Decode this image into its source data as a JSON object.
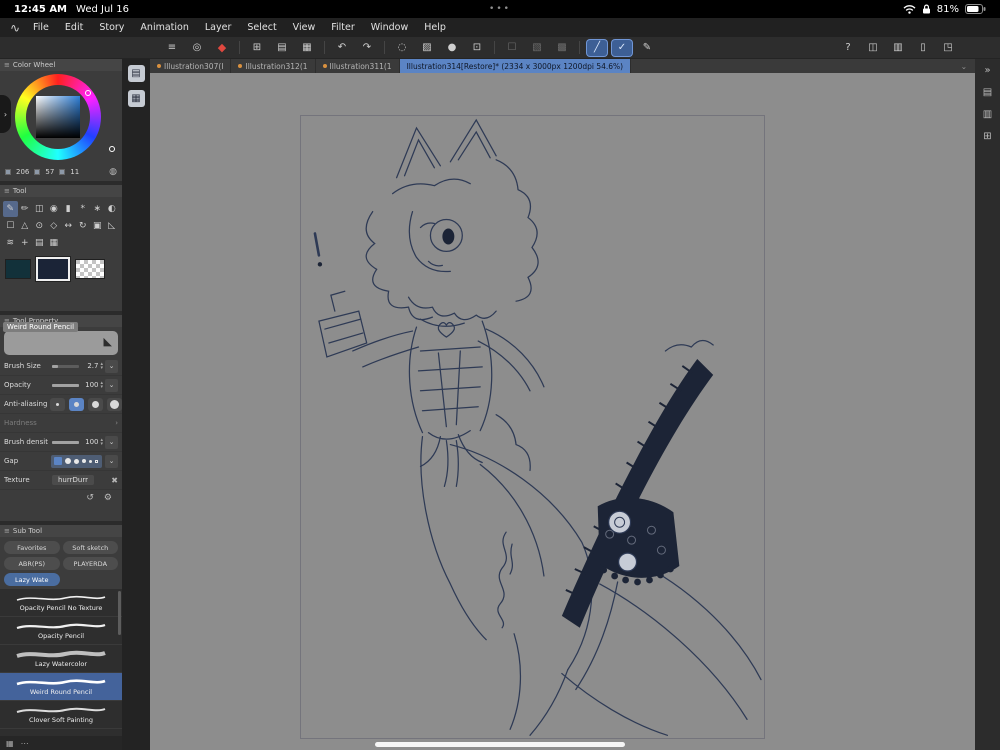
{
  "colors": {
    "accent": "#5b84c4",
    "accent-deep": "#3d5f95",
    "canvas": "#8d8d8d",
    "ink": "#2e3a55",
    "ink-dark": "#1c2436",
    "brand-red": "#e0483f",
    "tab-dot": "#d9913f",
    "swatch-main": "#12313a",
    "swatch-sub": "#1b2437"
  },
  "glyphs": {
    "menu": "≡",
    "step_up": "▴",
    "step_down": "▾",
    "chevron_down": "⌄",
    "chevron_right": "›",
    "trash": "✖",
    "reset": "↺",
    "wrench": "⚙",
    "overflow": "⌄",
    "collapse": "»",
    "brush_tip": "◣",
    "dots": "⋯"
  },
  "status_bar": {
    "time": "12:45 AM",
    "date": "Wed Jul 16",
    "center": "•••",
    "battery_percent": "81%"
  },
  "menu_bar": {
    "logo_glyph": "∿",
    "items": [
      "File",
      "Edit",
      "Story",
      "Animation",
      "Layer",
      "Select",
      "View",
      "Filter",
      "Window",
      "Help"
    ]
  },
  "toolbar": {
    "buttons": [
      {
        "name": "main-menu",
        "glyph": "≡"
      },
      {
        "name": "quick-access",
        "glyph": "◎"
      },
      {
        "name": "clip-studio",
        "glyph": "◆"
      },
      {
        "name": "new-canvas",
        "glyph": "⊞"
      },
      {
        "name": "open-file",
        "glyph": "▤"
      },
      {
        "name": "save",
        "glyph": "▦"
      },
      {
        "name": "undo",
        "glyph": "↶"
      },
      {
        "name": "redo",
        "glyph": "↷"
      },
      {
        "name": "refresh",
        "glyph": "◌"
      },
      {
        "name": "material",
        "glyph": "▨"
      },
      {
        "name": "blend",
        "glyph": "●"
      },
      {
        "name": "crop",
        "glyph": "⊡"
      },
      {
        "name": "select-rect",
        "glyph": "☐"
      },
      {
        "name": "select-wand",
        "glyph": "▧"
      },
      {
        "name": "deselect",
        "glyph": "▩"
      },
      {
        "name": "line-tool",
        "glyph": "╱"
      },
      {
        "name": "check-tool",
        "glyph": "✓"
      },
      {
        "name": "pen-stroke",
        "glyph": "✎"
      },
      {
        "name": "help",
        "glyph": "?"
      },
      {
        "name": "panel-left",
        "glyph": "◫"
      },
      {
        "name": "panel-right",
        "glyph": "▥"
      },
      {
        "name": "tablet",
        "glyph": "▯"
      },
      {
        "name": "fullscreen",
        "glyph": "◳"
      }
    ]
  },
  "tab_bar": {
    "tabs": [
      {
        "label": "Illustration307(I",
        "active": false
      },
      {
        "label": "Illustration312(1",
        "active": false
      },
      {
        "label": "Illustration311(1",
        "active": false
      },
      {
        "label": "Illustration314[Restore]* (2334 x 3000px 1200dpi 54.6%)",
        "active": true
      }
    ]
  },
  "color_wheel": {
    "title": "Color Wheel",
    "hue": "206",
    "sat": "57",
    "val": "11"
  },
  "tool": {
    "title": "Tool",
    "icons": [
      {
        "name": "pen-tool",
        "glyph": "✎"
      },
      {
        "name": "pencil-tool",
        "glyph": "✏"
      },
      {
        "name": "eraser-tool",
        "glyph": "◫"
      },
      {
        "name": "eyedropper-tool",
        "glyph": "◉"
      },
      {
        "name": "brush-tool",
        "glyph": "▮"
      },
      {
        "name": "airbrush-tool",
        "glyph": "*"
      },
      {
        "name": "decoration-tool",
        "glyph": "∗"
      },
      {
        "name": "blend-tool",
        "glyph": "◐"
      },
      {
        "name": "selection-tool",
        "glyph": "☐"
      },
      {
        "name": "auto-select-tool",
        "glyph": "△"
      },
      {
        "name": "zoom-tool",
        "glyph": "⊙"
      },
      {
        "name": "gradient-tool",
        "glyph": "◇"
      },
      {
        "name": "move-tool",
        "glyph": "↔"
      },
      {
        "name": "rotate-tool",
        "glyph": "↻"
      },
      {
        "name": "operation-tool",
        "glyph": "▣"
      },
      {
        "name": "figure-tool",
        "glyph": "◺"
      },
      {
        "name": "stroke-tool",
        "glyph": "≋"
      },
      {
        "name": "add-tool",
        "glyph": "+"
      },
      {
        "name": "balloon-tool",
        "glyph": "▤"
      },
      {
        "name": "frame-tool",
        "glyph": "▦"
      }
    ]
  },
  "tool_property": {
    "title": "Tool Property",
    "brush_name": "Weird Round Pencil",
    "brush_size": {
      "label": "Brush Size",
      "value": "2.7"
    },
    "opacity": {
      "label": "Opacity",
      "value": "100"
    },
    "anti_aliasing": {
      "label": "Anti-aliasing"
    },
    "hardness": {
      "label": "Hardness"
    },
    "brush_density": {
      "label": "Brush density",
      "value": "100"
    },
    "gap": {
      "label": "Gap"
    },
    "texture": {
      "label": "Texture",
      "value": "hurrDurr"
    }
  },
  "sub_tool": {
    "title": "Sub Tool",
    "groups": [
      {
        "label": "Favorites",
        "active": false
      },
      {
        "label": "Soft sketch",
        "active": false
      },
      {
        "label": "ABR(PS)",
        "active": false
      },
      {
        "label": "PLAYERDA",
        "active": false
      },
      {
        "label": "Lazy Wate",
        "active": true
      }
    ],
    "brushes": [
      {
        "name": "Opacity Pencil No Texture",
        "selected": false
      },
      {
        "name": "Opacity Pencil",
        "selected": false
      },
      {
        "name": "Lazy Watercolor",
        "selected": false
      },
      {
        "name": "Weird Round Pencil",
        "selected": true
      },
      {
        "name": "Clover Soft Painting",
        "selected": false
      }
    ]
  },
  "left_dock": {
    "icons": [
      {
        "name": "quick-access-palette",
        "glyph": "▤"
      },
      {
        "name": "material-palette",
        "glyph": "▦"
      }
    ]
  },
  "right_dock": {
    "icons": [
      {
        "name": "collapse",
        "glyph": "»"
      },
      {
        "name": "material-drawer",
        "glyph": "▤"
      },
      {
        "name": "layer-drawer",
        "glyph": "▥"
      },
      {
        "name": "navigator-drawer",
        "glyph": "⊞"
      }
    ]
  },
  "bottom_bar": {
    "icon_glyph": "▦",
    "dots": "⋯"
  }
}
